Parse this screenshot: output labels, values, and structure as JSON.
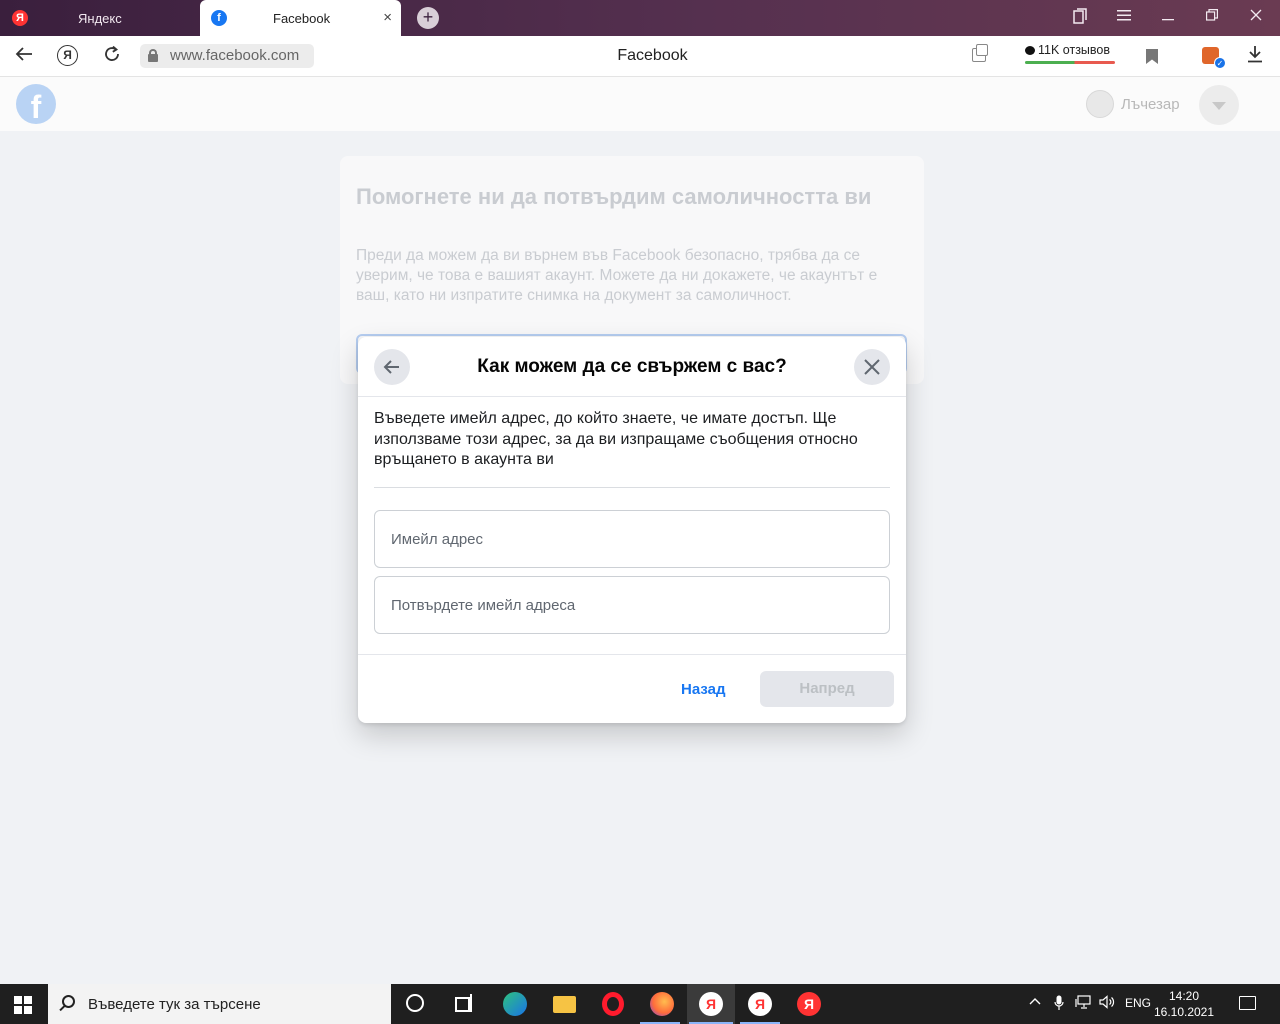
{
  "browser": {
    "tabs": [
      {
        "label": "Яндекс",
        "favicon": "Я"
      },
      {
        "label": "Facebook",
        "favicon": "f"
      }
    ],
    "tab_close_label": "×",
    "new_tab_label": "+",
    "url": "www.facebook.com",
    "yandex_button": "Я",
    "page_title": "Facebook",
    "reviews": "11K отзывов"
  },
  "facebook": {
    "logo": "f",
    "user_name": "Лъчезар",
    "card": {
      "title": "Помогнете ни да потвърдим самоличността ви",
      "description": "Преди да можем да ви върнем във Facebook безопасно, трябва да се уверим, че това е вашият акаунт. Можете да ни докажете, че акаунтът е ваш, като ни изпратите снимка на документ за самоличност."
    }
  },
  "modal": {
    "title": "Как можем да се свържем с вас?",
    "description": "Въведете имейл адрес, до който знаете, че имате достъп. Ще използваме този адрес, за да ви изпращаме съобщения относно връщането в акаунта ви",
    "email_placeholder": "Имейл адрес",
    "confirm_placeholder": "Потвърдете имейл адреса",
    "back_label": "Назад",
    "next_label": "Напред"
  },
  "taskbar": {
    "search_placeholder": "Въведете тук за търсене",
    "ya_label": "Я",
    "language": "ENG",
    "time": "14:20",
    "date": "16.10.2021 г."
  },
  "colors": {
    "facebook_blue": "#1877f2",
    "tab_bar": "#55304f",
    "yandex_red": "#ff3333"
  }
}
